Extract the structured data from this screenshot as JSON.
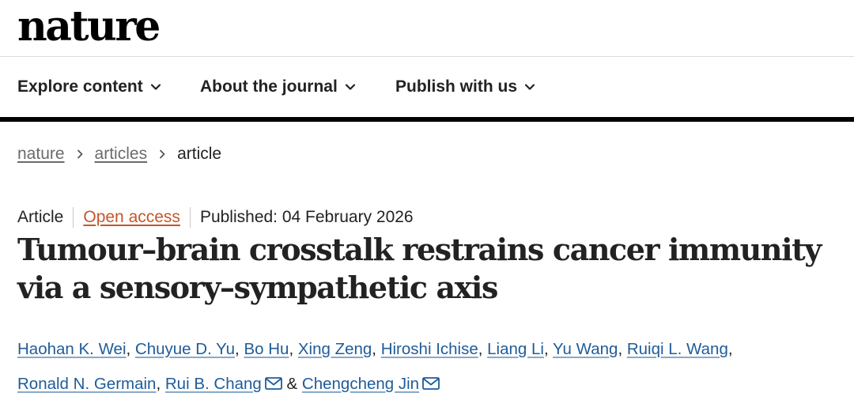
{
  "brand": {
    "logo_text": "nature"
  },
  "nav": {
    "items": [
      {
        "label": "Explore content"
      },
      {
        "label": "About the journal"
      },
      {
        "label": "Publish with us"
      }
    ]
  },
  "breadcrumb": {
    "items": [
      "nature",
      "articles"
    ],
    "current": "article"
  },
  "article": {
    "type": "Article",
    "access": "Open access",
    "published": "Published: 04 February 2026",
    "title": "Tumour–brain crosstalk restrains cancer immunity via a sensory–sympathetic axis",
    "authors": [
      "Haohan K. Wei",
      "Chuyue D. Yu",
      "Bo Hu",
      "Xing Zeng",
      "Hiroshi Ichise",
      "Liang Li",
      "Yu Wang",
      "Ruiqi L. Wang",
      "Ronald N. Germain",
      "Rui B. Chang",
      "Chengcheng Jin"
    ],
    "author_sep": ",",
    "author_and": "&"
  },
  "colors": {
    "link": "#1f5c99",
    "open_access": "#c2572a",
    "breadcrumb_link": "#6b6b6b",
    "text": "#222222"
  },
  "icons": {
    "nav_chevron": "chevron-down-icon",
    "breadcrumb_separator": "chevron-right-icon",
    "corresponding_author": "mail-icon"
  }
}
